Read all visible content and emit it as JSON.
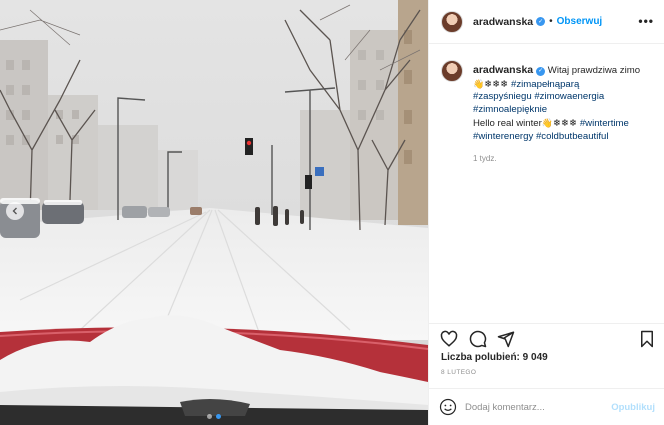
{
  "post": {
    "username": "aradwanska",
    "separator": "•",
    "follow_label": "Obserwuj",
    "more_label": "•••",
    "caption": {
      "text_1": "Witaj prawdziwa zimo",
      "emoji_1": "👋",
      "snow_1": "❄❄❄",
      "tag_1": "#zimapełnąparą",
      "tag_2": "#zaspyśniegu",
      "tag_3": "#zimowaenergia",
      "tag_4": "#zimnoalepięknie",
      "text_2": "Hello real winter",
      "emoji_2": "👋",
      "snow_2": "❄❄❄",
      "tag_5": "#wintertime",
      "tag_6": "#winterenergy",
      "tag_7": "#coldbutbeautiful"
    },
    "comment_age": "1 tydz.",
    "likes": "Liczba polubień: 9 049",
    "date": "8 LUTEGO",
    "comment_placeholder": "Dodaj komentarz...",
    "post_label": "Opublikuj"
  },
  "carousel": {
    "slide_count": 2,
    "active_slide": 1
  },
  "icons": {
    "like": "heart-icon",
    "comment": "comment-icon",
    "share": "share-icon",
    "save": "bookmark-icon",
    "emoji": "emoji-icon",
    "prev": "chevron-left-icon",
    "verified": "verified-badge-icon"
  },
  "colors": {
    "accent": "#0095f6",
    "hashtag": "#00376b",
    "muted": "#8e8e8e",
    "post_disabled": "#b2dffc",
    "carousel_dot_active": "#3897f0"
  }
}
